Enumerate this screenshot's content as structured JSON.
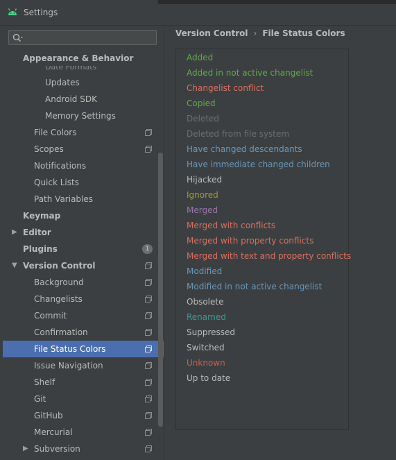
{
  "window": {
    "title": "Settings"
  },
  "search": {
    "placeholder": "",
    "value": ""
  },
  "sidebar": {
    "sticky_header": "Appearance & Behavior",
    "faded_item": "Date Formats",
    "items": [
      {
        "label": "Updates",
        "level": 3,
        "bold": false
      },
      {
        "label": "Android SDK",
        "level": 3,
        "bold": false
      },
      {
        "label": "Memory Settings",
        "level": 3,
        "bold": false
      },
      {
        "label": "File Colors",
        "level": 2,
        "bold": false,
        "proj": true
      },
      {
        "label": "Scopes",
        "level": 2,
        "bold": false,
        "proj": true
      },
      {
        "label": "Notifications",
        "level": 2,
        "bold": false
      },
      {
        "label": "Quick Lists",
        "level": 2,
        "bold": false
      },
      {
        "label": "Path Variables",
        "level": 2,
        "bold": false
      },
      {
        "label": "Keymap",
        "level": 1,
        "bold": true
      },
      {
        "label": "Editor",
        "level": 1,
        "bold": true,
        "arrow": "collapsed"
      },
      {
        "label": "Plugins",
        "level": 1,
        "bold": true,
        "badge": "1"
      },
      {
        "label": "Version Control",
        "level": 1,
        "bold": true,
        "arrow": "expanded",
        "proj": true
      },
      {
        "label": "Background",
        "level": 2,
        "bold": false,
        "proj": true
      },
      {
        "label": "Changelists",
        "level": 2,
        "bold": false,
        "proj": true
      },
      {
        "label": "Commit",
        "level": 2,
        "bold": false,
        "proj": true
      },
      {
        "label": "Confirmation",
        "level": 2,
        "bold": false,
        "proj": true
      },
      {
        "label": "File Status Colors",
        "level": 2,
        "bold": false,
        "proj": true,
        "selected": true
      },
      {
        "label": "Issue Navigation",
        "level": 2,
        "bold": false,
        "proj": true
      },
      {
        "label": "Shelf",
        "level": 2,
        "bold": false,
        "proj": true
      },
      {
        "label": "Git",
        "level": 2,
        "bold": false,
        "proj": true
      },
      {
        "label": "GitHub",
        "level": 2,
        "bold": false,
        "proj": true
      },
      {
        "label": "Mercurial",
        "level": 2,
        "bold": false,
        "proj": true
      },
      {
        "label": "Subversion",
        "level": 2,
        "bold": false,
        "proj": true,
        "arrow": "collapsed"
      }
    ]
  },
  "breadcrumb": {
    "parent": "Version Control",
    "separator": "›",
    "current": "File Status Colors"
  },
  "file_status_colors": [
    {
      "label": "Added",
      "color": "#62a94b"
    },
    {
      "label": "Added in not active changelist",
      "color": "#62a94b"
    },
    {
      "label": "Changelist conflict",
      "color": "#d87060"
    },
    {
      "label": "Copied",
      "color": "#62a94b"
    },
    {
      "label": "Deleted",
      "color": "#6e6e6e"
    },
    {
      "label": "Deleted from file system",
      "color": "#6e6e6e"
    },
    {
      "label": "Have changed descendants",
      "color": "#6897bb"
    },
    {
      "label": "Have immediate changed children",
      "color": "#6897bb"
    },
    {
      "label": "Hijacked",
      "color": "#bbbbbb"
    },
    {
      "label": "Ignored",
      "color": "#a09a3a"
    },
    {
      "label": "Merged",
      "color": "#9876aa"
    },
    {
      "label": "Merged with conflicts",
      "color": "#d87060"
    },
    {
      "label": "Merged with property conflicts",
      "color": "#d87060"
    },
    {
      "label": "Merged with text and property conflicts",
      "color": "#d87060"
    },
    {
      "label": "Modified",
      "color": "#6897bb"
    },
    {
      "label": "Modified in not active changelist",
      "color": "#6897bb"
    },
    {
      "label": "Obsolete",
      "color": "#bbbbbb"
    },
    {
      "label": "Renamed",
      "color": "#3a9a94"
    },
    {
      "label": "Suppressed",
      "color": "#bbbbbb"
    },
    {
      "label": "Switched",
      "color": "#bbbbbb"
    },
    {
      "label": "Unknown",
      "color": "#c86050"
    },
    {
      "label": "Up to date",
      "color": "#bbbbbb"
    }
  ],
  "colors": {
    "accent": "#4b6eaf",
    "android_icon": "#3ddc84"
  },
  "icons": {
    "app": "android-icon",
    "search": "search-icon",
    "project": "project-scope-icon"
  }
}
